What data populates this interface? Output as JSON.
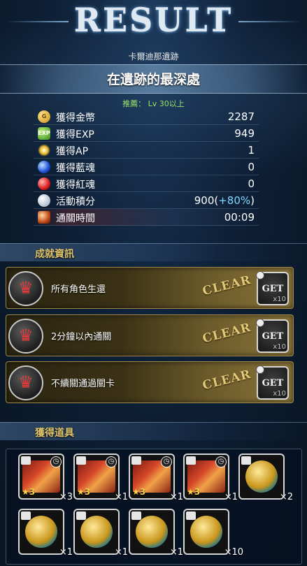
{
  "header": {
    "title": "RESULT",
    "dungeon_name": "卡爾迪那遺跡",
    "stage_name": "在遺跡的最深處",
    "recommend": "推薦： Lv 30以上"
  },
  "stats": [
    {
      "icon": "gold-coin-icon",
      "label": "獲得金幣",
      "value": "2287",
      "bonus": ""
    },
    {
      "icon": "exp-icon",
      "icon_text": "EXP",
      "label": "獲得EXP",
      "value": "949",
      "bonus": ""
    },
    {
      "icon": "ap-icon",
      "label": "獲得AP",
      "value": "1",
      "bonus": ""
    },
    {
      "icon": "blue-soul-icon",
      "label": "獲得藍魂",
      "value": "0",
      "bonus": ""
    },
    {
      "icon": "red-soul-icon",
      "label": "獲得紅魂",
      "value": "0",
      "bonus": ""
    },
    {
      "icon": "event-points-icon",
      "label": "活動積分",
      "value": "900(",
      "bonus": "+80%",
      "value_end": ")"
    },
    {
      "icon": "clear-time-icon",
      "label": "通關時間",
      "value": "00:09",
      "bonus": ""
    }
  ],
  "achievements": {
    "header": "成就資訊",
    "items": [
      {
        "label": "所有角色生還",
        "status": "CLEAR",
        "get_label": "GET",
        "qty": "x10"
      },
      {
        "label": "2分鐘以內通關",
        "status": "CLEAR",
        "get_label": "GET",
        "qty": "x10"
      },
      {
        "label": "不續關通過關卡",
        "status": "CLEAR",
        "get_label": "GET",
        "qty": "x10"
      }
    ]
  },
  "items": {
    "header": "獲得道具",
    "list": [
      {
        "type": "ticket",
        "rarity": "★3",
        "qty": "×3"
      },
      {
        "type": "ticket",
        "rarity": "★3",
        "qty": "×1"
      },
      {
        "type": "ticket",
        "rarity": "★3",
        "qty": "×1"
      },
      {
        "type": "ticket",
        "rarity": "★3",
        "qty": "×1"
      },
      {
        "type": "medal",
        "rarity": "",
        "qty": "×2"
      },
      {
        "type": "medal",
        "rarity": "",
        "qty": "×1"
      },
      {
        "type": "medal",
        "rarity": "",
        "qty": "×1"
      },
      {
        "type": "medal",
        "rarity": "",
        "qty": "×1"
      },
      {
        "type": "medal",
        "rarity": "",
        "qty": "×10"
      }
    ]
  }
}
